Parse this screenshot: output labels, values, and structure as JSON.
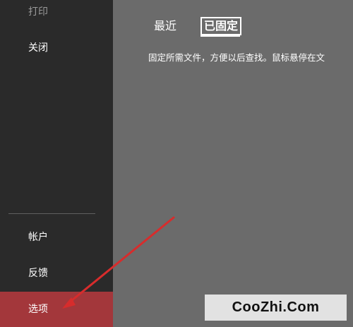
{
  "sidebar": {
    "items_top": [
      {
        "label": "打印"
      },
      {
        "label": "关闭"
      }
    ],
    "items_bottom": [
      {
        "label": "帐户"
      },
      {
        "label": "反馈"
      },
      {
        "label": "选项",
        "selected": true
      }
    ],
    "selected_color": "#a3373b"
  },
  "main": {
    "tabs": [
      {
        "label": "最近",
        "active": false
      },
      {
        "label": "已固定",
        "active": true
      }
    ],
    "description": "固定所需文件，方便以后查找。鼠标悬停在文"
  },
  "annotation": {
    "type": "arrow",
    "color": "#d72c2c",
    "points_to": "options"
  },
  "watermark": {
    "text": "CooZhi.Com"
  }
}
